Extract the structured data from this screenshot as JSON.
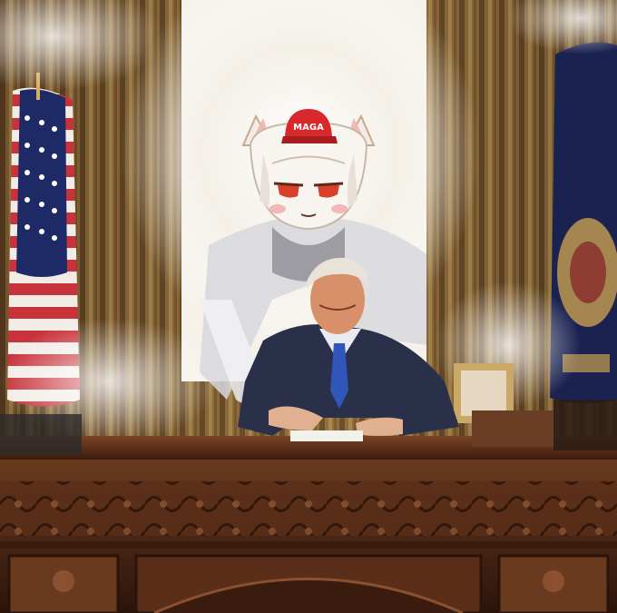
{
  "hat": {
    "text": "MAGA"
  },
  "colors": {
    "curtain": "#8a6a3a",
    "curtain_dark": "#3a2614",
    "desk": "#5a2e18",
    "desk_dark": "#2e160c",
    "suit": "#2a2f4a",
    "tie": "#2f56b8",
    "hat_red": "#d8282c",
    "glow": "#ffffff"
  }
}
